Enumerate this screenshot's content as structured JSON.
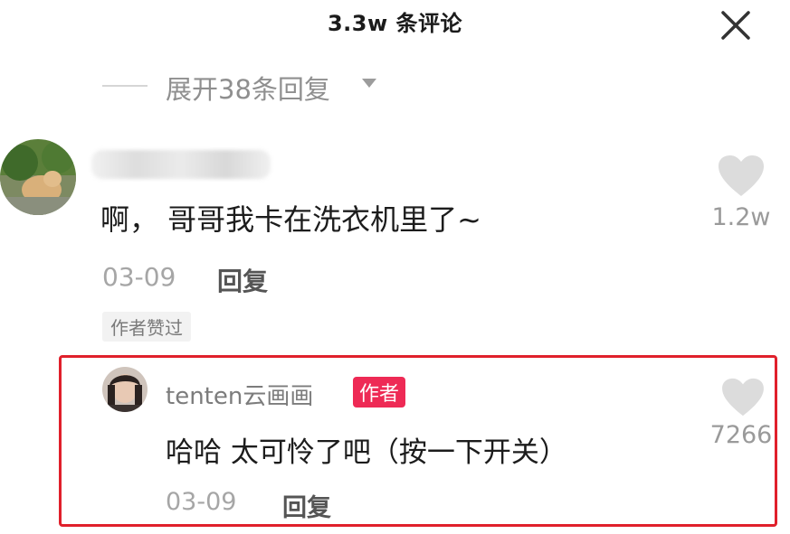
{
  "header": {
    "title": "3.3w 条评论",
    "close_icon": "close-icon"
  },
  "expand": {
    "label": "展开38条回复",
    "caret_icon": "caret-down-icon"
  },
  "comment": {
    "text": "啊， 哥哥我卡在洗衣机里了~",
    "date": "03-09",
    "reply_label": "回复",
    "liked_badge": "作者赞过",
    "like_count": "1.2w",
    "like_icon": "heart-icon"
  },
  "reply": {
    "username": "tenten云画画",
    "author_badge": "作者",
    "text": "哈哈 太可怜了吧（按一下开关）",
    "date": "03-09",
    "reply_label": "回复",
    "like_count": "7266",
    "like_icon": "heart-icon"
  },
  "colors": {
    "highlight_box": "#e0202b",
    "author_badge": "#ee2a55",
    "like_icon": "#dcdcdc"
  }
}
